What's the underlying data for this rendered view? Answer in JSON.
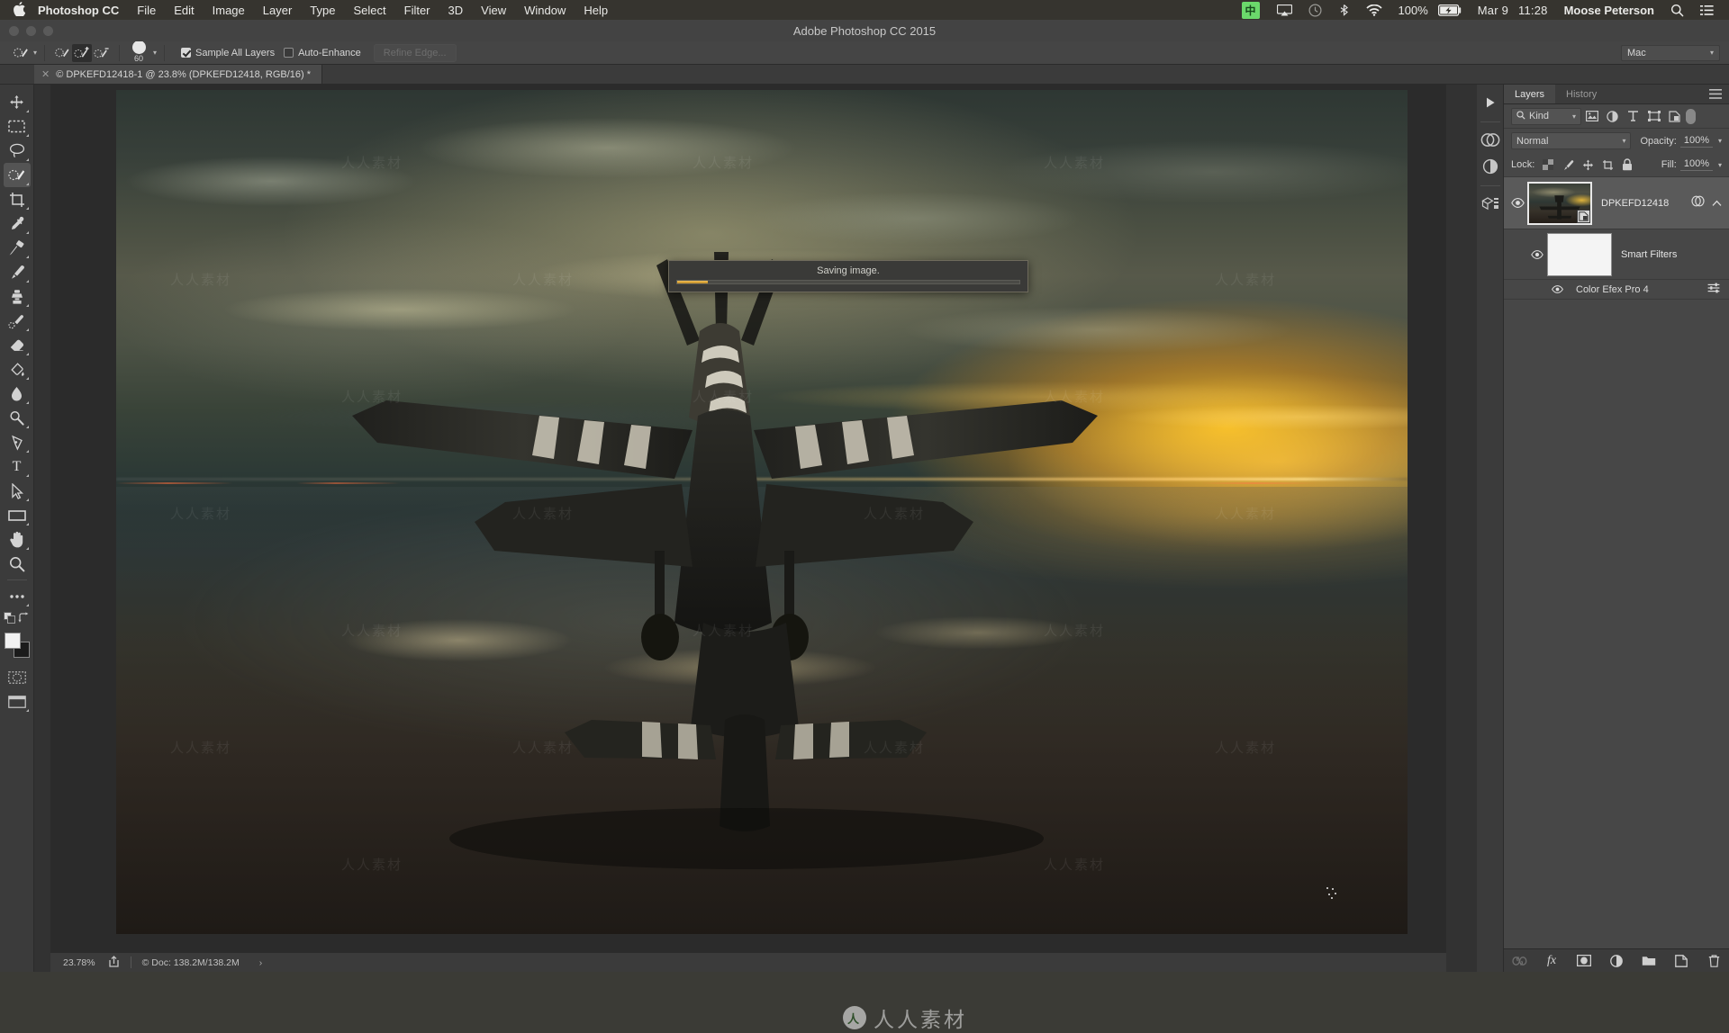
{
  "menubar": {
    "apple_icon": "apple-icon",
    "app_name": "Photoshop CC",
    "items": [
      "File",
      "Edit",
      "Image",
      "Layer",
      "Type",
      "Select",
      "Filter",
      "3D",
      "View",
      "Window",
      "Help"
    ],
    "ime_badge": "中",
    "icons": [
      "airplay-icon",
      "time-machine-icon",
      "bluetooth-icon",
      "wifi-icon"
    ],
    "battery_percent": "100%",
    "battery_icon": "battery-charging-icon",
    "date": "Mar 9",
    "time": "11:28",
    "user": "Moose Peterson",
    "search_icon": "search-icon",
    "notification_icon": "notification-center-icon"
  },
  "titlebar": {
    "title": "Adobe Photoshop CC 2015"
  },
  "options_bar": {
    "tool_preset_icon": "quick-selection-tool-icon",
    "modes": [
      "new-selection-icon",
      "add-to-selection-icon",
      "subtract-from-selection-icon"
    ],
    "active_mode_index": 1,
    "brush_size": "60",
    "sample_all_layers": {
      "label": "Sample All Layers",
      "checked": true
    },
    "auto_enhance": {
      "label": "Auto-Enhance",
      "checked": false
    },
    "refine_edge": {
      "label": "Refine Edge...",
      "enabled": false
    },
    "workspace": "Mac"
  },
  "document_tab": {
    "close_icon": "close-icon",
    "title": "© DPKEFD12418-1 @ 23.8% (DPKEFD12418, RGB/16) *"
  },
  "toolbar": {
    "tools": [
      {
        "name": "move-tool",
        "glyph": "✥"
      },
      {
        "name": "rectangular-marquee-tool",
        "glyph": "▭"
      },
      {
        "name": "lasso-tool",
        "glyph": "◯"
      },
      {
        "name": "quick-selection-tool",
        "glyph": "✎",
        "active": true
      },
      {
        "name": "crop-tool",
        "glyph": "⌗"
      },
      {
        "name": "eyedropper-tool",
        "glyph": "✐"
      },
      {
        "name": "spot-healing-brush-tool",
        "glyph": "✚"
      },
      {
        "name": "brush-tool",
        "glyph": "🖌"
      },
      {
        "name": "clone-stamp-tool",
        "glyph": "▯"
      },
      {
        "name": "history-brush-tool",
        "glyph": "✒"
      },
      {
        "name": "eraser-tool",
        "glyph": "◣"
      },
      {
        "name": "gradient-tool",
        "glyph": "◧"
      },
      {
        "name": "blur-tool",
        "glyph": "💧"
      },
      {
        "name": "dodge-tool",
        "glyph": "●"
      },
      {
        "name": "pen-tool",
        "glyph": "✑"
      },
      {
        "name": "type-tool",
        "glyph": "T"
      },
      {
        "name": "path-selection-tool",
        "glyph": "➤"
      },
      {
        "name": "rectangle-tool",
        "glyph": "▬"
      },
      {
        "name": "hand-tool",
        "glyph": "✋"
      },
      {
        "name": "zoom-tool",
        "glyph": "🔍"
      },
      {
        "name": "edit-toolbar-tool",
        "glyph": "•••"
      }
    ],
    "foreground_color": "#f2f2f2",
    "background_color": "#1b1b1b",
    "quick-mask-icon": "quick-mask-mode-icon",
    "screen-mode-icon": "screen-mode-icon"
  },
  "progress_dialog": {
    "message": "Saving image.",
    "percent": 9
  },
  "status_bar": {
    "zoom": "23.78%",
    "share_icon": "share-icon",
    "doc_label": "© Doc: 138.2M/138.2M",
    "arrow": "›"
  },
  "rail": {
    "buttons": [
      "expand-panels-icon",
      "creative-cloud-libraries-icon",
      "adjustments-icon",
      "libraries-icon"
    ]
  },
  "layers_panel": {
    "tabs": [
      {
        "label": "Layers",
        "active": true
      },
      {
        "label": "History",
        "active": false
      }
    ],
    "menu_icon": "panel-menu-icon",
    "filter": {
      "kind_label": "Kind",
      "search_icon": "search-icon",
      "filter_icons": [
        "pixel-layers-icon",
        "adjustment-layers-icon",
        "type-layers-icon",
        "shape-layers-icon",
        "smart-object-layers-icon"
      ],
      "toggle_icon": "filter-toggle-icon"
    },
    "blend_mode": "Normal",
    "opacity_label": "Opacity:",
    "opacity_value": "100%",
    "lock_label": "Lock:",
    "lock_icons": [
      "lock-transparent-pixels-icon",
      "lock-image-pixels-icon",
      "lock-position-icon",
      "lock-artboard-icon",
      "lock-all-icon"
    ],
    "fill_label": "Fill:",
    "fill_value": "100%",
    "layers": [
      {
        "name": "DPKEFD12418",
        "visible": true,
        "selected": true,
        "smart_object_icon": "smart-object-badge-icon",
        "link_icon": "smart-filters-badge-icon",
        "collapse_icon": "chevron-up-icon"
      }
    ],
    "smart_filters": {
      "label": "Smart Filters",
      "visible": true,
      "effects": [
        {
          "name": "Color Efex Pro 4",
          "visible": true,
          "settings_icon": "filter-settings-icon"
        }
      ]
    },
    "footer_buttons": [
      {
        "name": "link-layers-icon",
        "glyph": "∞",
        "enabled": false
      },
      {
        "name": "layer-style-icon",
        "glyph": "fx",
        "enabled": true
      },
      {
        "name": "layer-mask-icon",
        "glyph": "▣",
        "enabled": true
      },
      {
        "name": "adjustment-layer-icon",
        "glyph": "◐",
        "enabled": true
      },
      {
        "name": "new-group-icon",
        "glyph": "▤",
        "enabled": true
      },
      {
        "name": "new-layer-icon",
        "glyph": "▢",
        "enabled": true
      },
      {
        "name": "delete-layer-icon",
        "glyph": "🗑",
        "enabled": true
      }
    ]
  },
  "canvas": {
    "artwork_description": "P-51 Mustang fighter plane silhouette on an airfield at sunset with dramatic clouds",
    "watermark_text": "人人素材",
    "watermark_brand": "人人素材"
  }
}
